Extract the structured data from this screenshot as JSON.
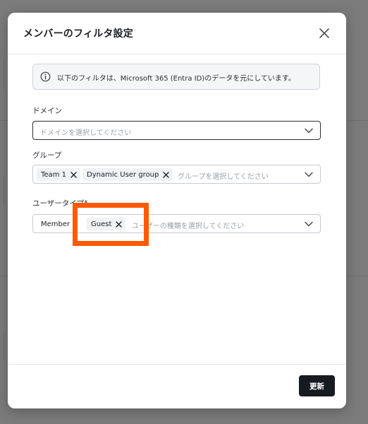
{
  "modal": {
    "title": "メンバーのフィルタ設定",
    "info_text": "以下のフィルタは、Microsoft 365 (Entra ID)のデータを元にしています。"
  },
  "fields": {
    "domain": {
      "label": "ドメイン",
      "placeholder": "ドメインを選択してください"
    },
    "group": {
      "label": "グループ",
      "placeholder": "グループを選択してください",
      "chips": [
        "Team 1",
        "Dynamic User group"
      ]
    },
    "user_type": {
      "label": "ユーザータイプ*",
      "placeholder": "ユーザーの種類を選択してください",
      "chips": [
        "Member",
        "Guest"
      ]
    }
  },
  "footer": {
    "update_label": "更新"
  },
  "icons": {
    "close": "close-icon",
    "info": "info-icon",
    "chevron": "chevron-down-icon",
    "chip_remove": "x-icon"
  },
  "colors": {
    "primary_button": "#161a21",
    "highlight": "#ff5a00",
    "overlay": "#7b7b7b"
  }
}
